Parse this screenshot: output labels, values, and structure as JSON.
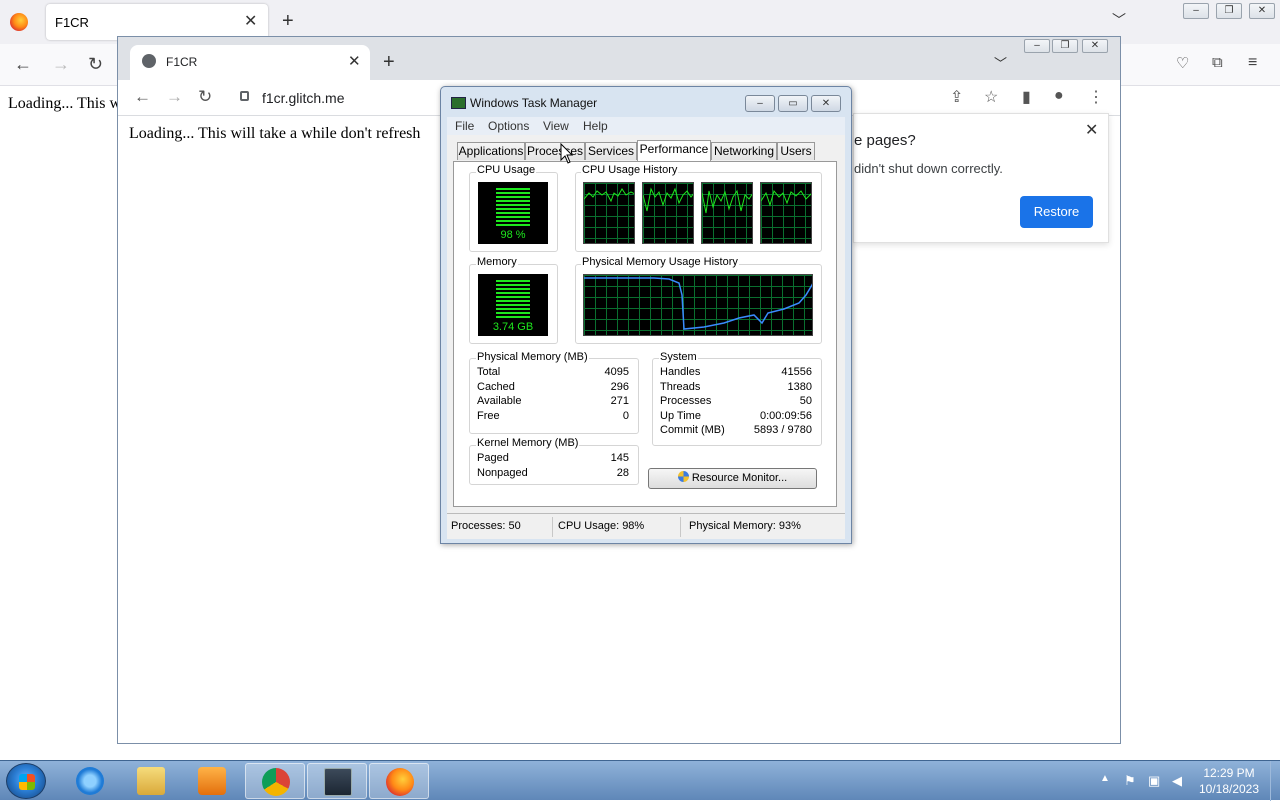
{
  "firefox": {
    "tab_title": "F1CR",
    "content_text": "Loading... This w",
    "win_controls": [
      "–",
      "❐",
      "✕"
    ]
  },
  "chrome": {
    "tab_title": "F1CR",
    "url": "f1cr.glitch.me",
    "page_text": "Loading... This will take a while don't refresh",
    "win_controls": [
      "–",
      "❐",
      "✕"
    ],
    "restore_popup": {
      "title": "e pages?",
      "message": "didn't shut down correctly.",
      "button": "Restore"
    }
  },
  "task_manager": {
    "title": "Windows Task Manager",
    "menu": [
      "File",
      "Options",
      "View",
      "Help"
    ],
    "tabs": [
      "Applications",
      "Processes",
      "Services",
      "Performance",
      "Networking",
      "Users"
    ],
    "active_tab": "Performance",
    "cpu_usage_label": "CPU Usage",
    "cpu_usage_value": "98 %",
    "cpu_usage_percent": 98,
    "cpu_history_label": "CPU Usage History",
    "memory_label": "Memory",
    "memory_value": "3.74 GB",
    "memory_percent": 93,
    "phys_history_label": "Physical Memory Usage History",
    "physical_memory": {
      "label": "Physical Memory (MB)",
      "rows": [
        {
          "k": "Total",
          "v": "4095"
        },
        {
          "k": "Cached",
          "v": "296"
        },
        {
          "k": "Available",
          "v": "271"
        },
        {
          "k": "Free",
          "v": "0"
        }
      ]
    },
    "kernel_memory": {
      "label": "Kernel Memory (MB)",
      "rows": [
        {
          "k": "Paged",
          "v": "145"
        },
        {
          "k": "Nonpaged",
          "v": "28"
        }
      ]
    },
    "system": {
      "label": "System",
      "rows": [
        {
          "k": "Handles",
          "v": "41556"
        },
        {
          "k": "Threads",
          "v": "1380"
        },
        {
          "k": "Processes",
          "v": "50"
        },
        {
          "k": "Up Time",
          "v": "0:00:09:56"
        },
        {
          "k": "Commit (MB)",
          "v": "5893 / 9780"
        }
      ]
    },
    "resource_monitor_button": "Resource Monitor...",
    "status": {
      "processes": "Processes: 50",
      "cpu": "CPU Usage: 98%",
      "memory": "Physical Memory: 93%"
    }
  },
  "taskbar": {
    "time": "12:29 PM",
    "date": "10/18/2023"
  }
}
